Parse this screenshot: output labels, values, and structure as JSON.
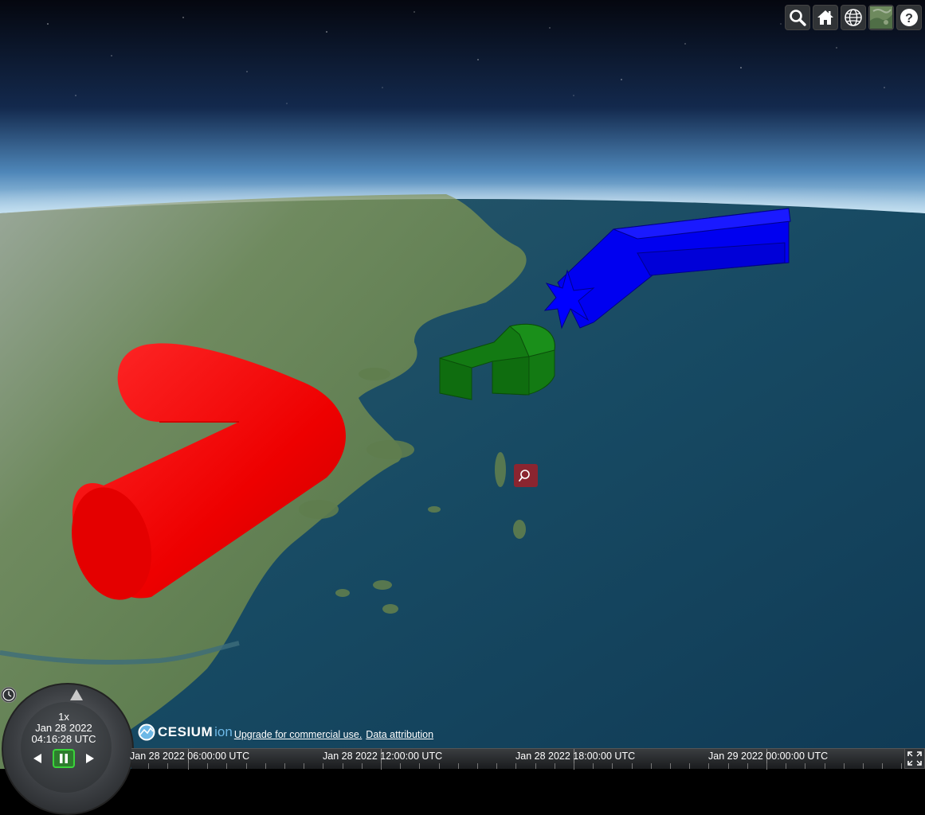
{
  "toolbar": {
    "buttons": [
      {
        "name": "geocoder-search-button",
        "icon": "search-icon"
      },
      {
        "name": "home-button",
        "icon": "home-icon"
      },
      {
        "name": "scene-mode-button",
        "icon": "globe-icon"
      },
      {
        "name": "base-layer-picker-button",
        "icon": "imagery-thumbnail-icon"
      },
      {
        "name": "help-button",
        "icon": "question-icon"
      }
    ]
  },
  "animation": {
    "speed": "1x",
    "date": "Jan 28 2022",
    "time": "04:16:28 UTC"
  },
  "credits": {
    "logo_text": "CESIUM",
    "logo_suffix": "ion",
    "upgrade_link": "Upgrade for commercial use.",
    "attribution_link": "Data attribution"
  },
  "timeline": {
    "labels": [
      "Jan 28 2022 06:00:00 UTC",
      "Jan 28 2022 12:00:00 UTC",
      "Jan 28 2022 18:00:00 UTC",
      "Jan 29 2022 00:00:00 UTC"
    ]
  },
  "scene": {
    "entities": [
      {
        "name": "red-tube",
        "color": "#ff0000"
      },
      {
        "name": "green-volume",
        "color": "#0f7a0f"
      },
      {
        "name": "blue-star-volume",
        "color": "#0000ff"
      }
    ],
    "ocean_color": "#17445e",
    "sky_color": "#0d1a33"
  }
}
